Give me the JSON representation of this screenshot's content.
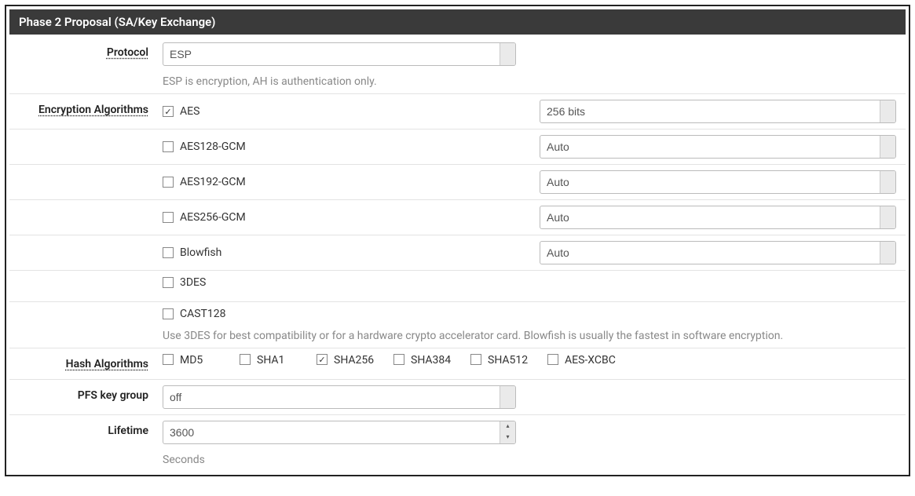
{
  "panel": {
    "title": "Phase 2 Proposal (SA/Key Exchange)"
  },
  "labels": {
    "protocol": "Protocol",
    "encryption": "Encryption Algorithms",
    "hash": "Hash Algorithms",
    "pfs": "PFS key group",
    "lifetime": "Lifetime"
  },
  "protocol": {
    "value": "ESP",
    "help": "ESP is encryption, AH is authentication only."
  },
  "encryption": {
    "rows": [
      {
        "name": "AES",
        "checked": true,
        "key_size": "256 bits"
      },
      {
        "name": "AES128-GCM",
        "checked": false,
        "key_size": "Auto"
      },
      {
        "name": "AES192-GCM",
        "checked": false,
        "key_size": "Auto"
      },
      {
        "name": "AES256-GCM",
        "checked": false,
        "key_size": "Auto"
      },
      {
        "name": "Blowfish",
        "checked": false,
        "key_size": "Auto"
      },
      {
        "name": "3DES",
        "checked": false,
        "key_size": null
      },
      {
        "name": "CAST128",
        "checked": false,
        "key_size": null
      }
    ],
    "help": "Use 3DES for best compatibility or for a hardware crypto accelerator card. Blowfish is usually the fastest in software encryption."
  },
  "hash": {
    "options": [
      {
        "name": "MD5",
        "checked": false
      },
      {
        "name": "SHA1",
        "checked": false
      },
      {
        "name": "SHA256",
        "checked": true
      },
      {
        "name": "SHA384",
        "checked": false
      },
      {
        "name": "SHA512",
        "checked": false
      },
      {
        "name": "AES-XCBC",
        "checked": false
      }
    ]
  },
  "pfs": {
    "value": "off"
  },
  "lifetime": {
    "value": "3600",
    "unit": "Seconds"
  }
}
